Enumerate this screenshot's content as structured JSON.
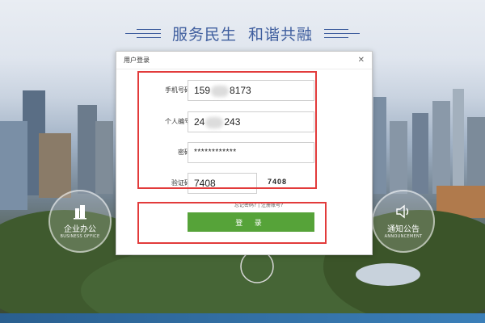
{
  "slogan": {
    "left": "服务民生",
    "right": "和谐共融"
  },
  "dialog": {
    "title": "用户登录",
    "close_icon": "close-icon",
    "fields": {
      "phone": {
        "label": "手机号码",
        "value_start": "159",
        "value_end": "8173"
      },
      "id_number": {
        "label": "个人编号",
        "value_start": "24",
        "value_end": "243"
      },
      "password": {
        "label": "密码",
        "value": "************"
      },
      "captcha": {
        "label": "验证码",
        "value": "7408",
        "image_text": "7408"
      }
    },
    "hint": "忘记密码?  |  注册账号?",
    "login_button": "登  录"
  },
  "side_buttons": {
    "left": {
      "label": "企业办公",
      "sub": "BUSINESS OFFICE",
      "icon": "building-icon"
    },
    "right": {
      "label": "通知公告",
      "sub": "ANNOUNCEMENT",
      "icon": "speaker-icon"
    }
  },
  "colors": {
    "accent_blue": "#3f5e9e",
    "login_green": "#56a339",
    "highlight_red": "#e23b3b"
  }
}
